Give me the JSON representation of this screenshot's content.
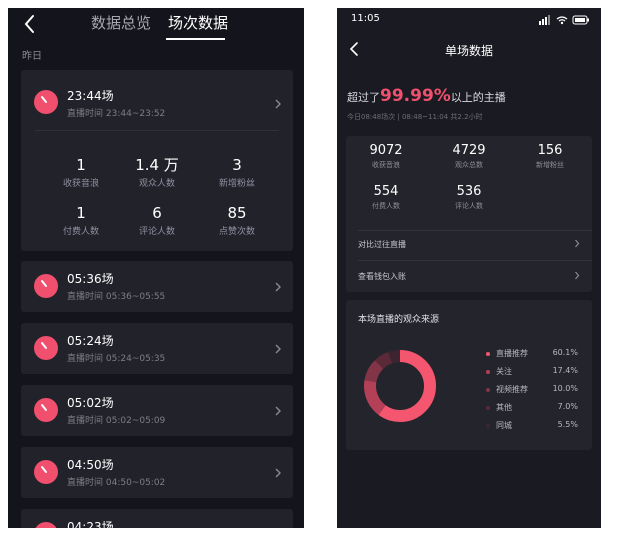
{
  "left": {
    "tabs": [
      "数据总览",
      "场次数据"
    ],
    "section_label": "昨日",
    "featured": {
      "title": "23:44场",
      "subtitle": "直播时间 23:44~23:52",
      "stats": [
        {
          "value": "1",
          "label": "收获音浪"
        },
        {
          "value": "1.4 万",
          "label": "观众人数"
        },
        {
          "value": "3",
          "label": "新增粉丝"
        },
        {
          "value": "1",
          "label": "付费人数"
        },
        {
          "value": "6",
          "label": "评论人数"
        },
        {
          "value": "85",
          "label": "点赞次数"
        }
      ]
    },
    "sessions": [
      {
        "title": "05:36场",
        "subtitle": "直播时间 05:36~05:55"
      },
      {
        "title": "05:24场",
        "subtitle": "直播时间 05:24~05:35"
      },
      {
        "title": "05:02场",
        "subtitle": "直播时间 05:02~05:09"
      },
      {
        "title": "04:50场",
        "subtitle": "直播时间 04:50~05:02"
      },
      {
        "title": "04:23场",
        "subtitle": ""
      }
    ]
  },
  "right": {
    "status_time": "11:05",
    "title": "单场数据",
    "exceed_prefix": "超过了",
    "exceed_pct": "99.99%",
    "exceed_suffix": "以上的主播",
    "meta": "今日08:48场次 | 08:48~11:04 共2.2小时",
    "stats": [
      {
        "value": "9072",
        "label": "收获音浪"
      },
      {
        "value": "4729",
        "label": "观众总数"
      },
      {
        "value": "156",
        "label": "新增粉丝"
      },
      {
        "value": "554",
        "label": "付费人数"
      },
      {
        "value": "536",
        "label": "评论人数"
      }
    ],
    "rows": [
      "对比过往直播",
      "查看钱包入账"
    ],
    "source_title": "本场直播的观众来源",
    "sources": [
      {
        "name": "直播推荐",
        "value": "60.1%",
        "pct": 60.1,
        "color": "#f5566f"
      },
      {
        "name": "关注",
        "value": "17.4%",
        "pct": 17.4,
        "color": "#b44058"
      },
      {
        "name": "视频推荐",
        "value": "10.0%",
        "pct": 10.0,
        "color": "#843447"
      },
      {
        "name": "其他",
        "value": "7.0%",
        "pct": 7.0,
        "color": "#5b2a38"
      },
      {
        "name": "同城",
        "value": "5.5%",
        "pct": 5.5,
        "color": "#3d2530"
      }
    ],
    "colors": {
      "accent": "#f0506e"
    }
  }
}
